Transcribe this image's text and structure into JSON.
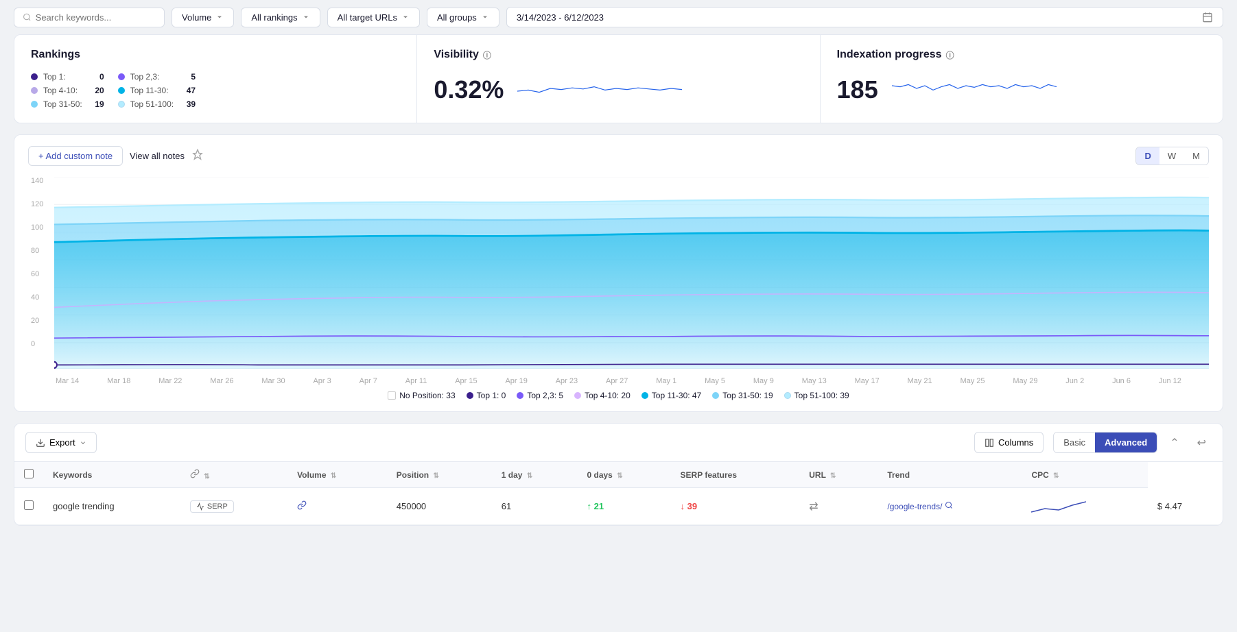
{
  "topbar": {
    "search_placeholder": "Search keywords...",
    "filter1": {
      "label": "Volume",
      "value": "Volume"
    },
    "filter2": {
      "label": "All rankings",
      "value": "All rankings"
    },
    "filter3": {
      "label": "All target URLs",
      "value": "All target URLs"
    },
    "filter4": {
      "label": "All groups",
      "value": "All groups"
    },
    "date_range": "3/14/2023 - 6/12/2023"
  },
  "rankings_card": {
    "title": "Rankings",
    "items_left": [
      {
        "label": "Top 1:",
        "value": "0",
        "color": "#3b1f8c"
      },
      {
        "label": "Top 4-10:",
        "value": "20",
        "color": "#b8a9e8"
      },
      {
        "label": "Top 31-50:",
        "value": "19",
        "color": "#7dd4f8"
      }
    ],
    "items_right": [
      {
        "label": "Top 2,3:",
        "value": "5",
        "color": "#7a5af8"
      },
      {
        "label": "Top 11-30:",
        "value": "47",
        "color": "#00b3e6"
      },
      {
        "label": "Top 51-100:",
        "value": "39",
        "color": "#b3ecff"
      }
    ]
  },
  "visibility_card": {
    "title": "Visibility",
    "value": "0.32%"
  },
  "indexation_card": {
    "title": "Indexation progress",
    "value": "185"
  },
  "chart": {
    "add_note_label": "+ Add custom note",
    "view_notes_label": "View all notes",
    "period_buttons": [
      "D",
      "W",
      "M"
    ],
    "active_period": "D",
    "y_labels": [
      "140",
      "120",
      "100",
      "80",
      "60",
      "40",
      "20",
      "0"
    ],
    "x_labels": [
      "Mar 14",
      "Mar 18",
      "Mar 22",
      "Mar 26",
      "Mar 30",
      "Apr 3",
      "Apr 7",
      "Apr 11",
      "Apr 15",
      "Apr 19",
      "Apr 23",
      "Apr 27",
      "May 1",
      "May 5",
      "May 9",
      "May 13",
      "May 17",
      "May 21",
      "May 25",
      "May 29",
      "Jun 2",
      "Jun 6",
      "Jun 12"
    ],
    "legend": [
      {
        "label": "No Position: 33",
        "type": "box",
        "color": "transparent",
        "border": "#ccc"
      },
      {
        "label": "Top 1: 0",
        "type": "dot",
        "color": "#3b1f8c"
      },
      {
        "label": "Top 2,3: 5",
        "type": "dot",
        "color": "#7a5af8"
      },
      {
        "label": "Top 4-10: 20",
        "type": "dot",
        "color": "#d8b4fe"
      },
      {
        "label": "Top 11-30: 47",
        "type": "dot",
        "color": "#00b3e6"
      },
      {
        "label": "Top 31-50: 19",
        "type": "dot",
        "color": "#7dd4f8"
      },
      {
        "label": "Top 51-100: 39",
        "type": "dot",
        "color": "#b3ecff"
      }
    ]
  },
  "table": {
    "export_label": "Export",
    "columns_label": "Columns",
    "view_basic": "Basic",
    "view_advanced": "Advanced",
    "columns": [
      {
        "key": "checkbox",
        "label": ""
      },
      {
        "key": "keyword",
        "label": "Keywords"
      },
      {
        "key": "link",
        "label": ""
      },
      {
        "key": "volume",
        "label": "Volume"
      },
      {
        "key": "position",
        "label": "Position"
      },
      {
        "key": "1day",
        "label": "1 day"
      },
      {
        "key": "0days",
        "label": "0 days"
      },
      {
        "key": "serp",
        "label": "SERP features"
      },
      {
        "key": "url",
        "label": "URL"
      },
      {
        "key": "trend",
        "label": "Trend"
      },
      {
        "key": "cpc",
        "label": "CPC"
      }
    ],
    "rows": [
      {
        "keyword": "google trending",
        "serp_badge": "SERP",
        "link_icon": true,
        "volume": "450000",
        "position": "61",
        "day1": "↑ 21",
        "day1_class": "up",
        "day0": "↓ 39",
        "day0_class": "down",
        "serp_feature": "⇄",
        "url": "/google-trends/",
        "cpc": "$ 4.47"
      }
    ]
  }
}
